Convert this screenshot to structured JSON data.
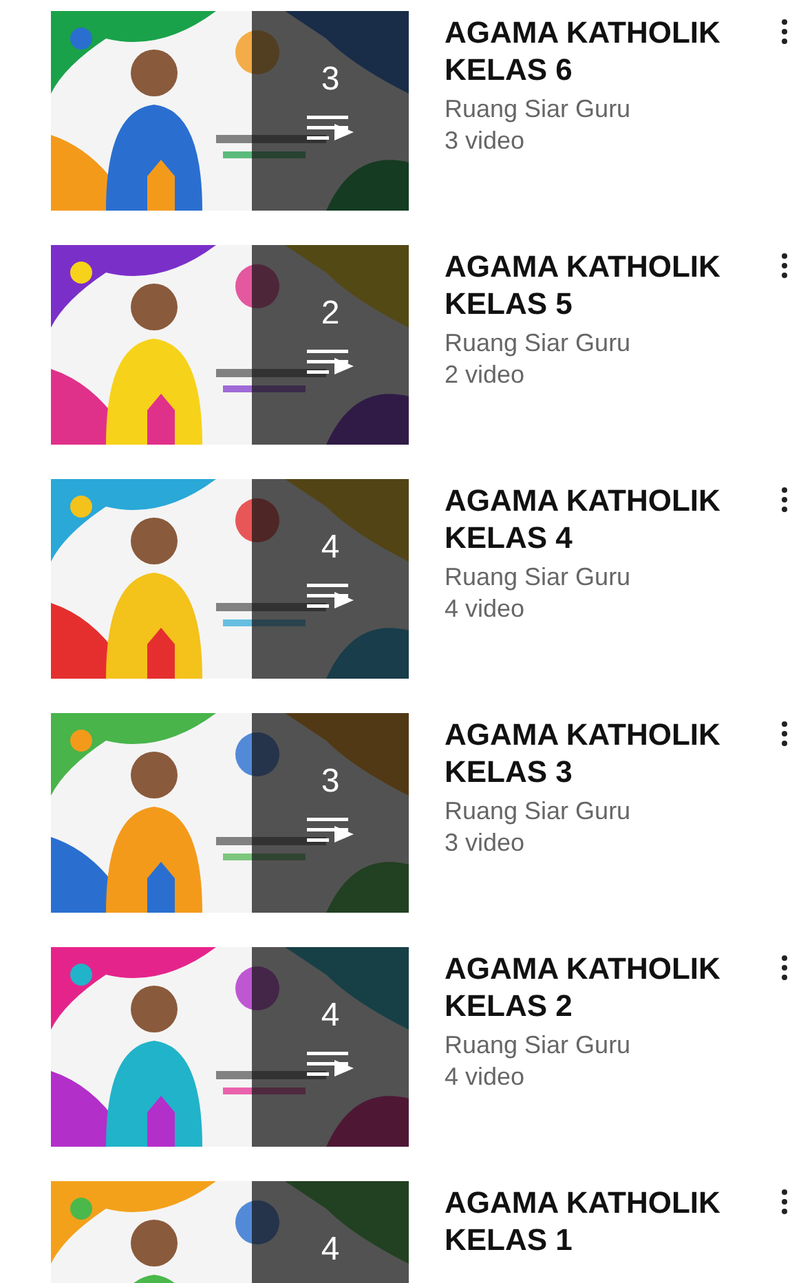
{
  "playlists": [
    {
      "count": "3",
      "playlist_icon": true,
      "title": "AGAMA KATHOLIK KELAS 6",
      "channel": "Ruang Siar Guru",
      "videos": "3 video"
    },
    {
      "count": "2",
      "playlist_icon": true,
      "title": "AGAMA KATHOLIK KELAS 5",
      "channel": "Ruang Siar Guru",
      "videos": "2 video"
    },
    {
      "count": "4",
      "playlist_icon": true,
      "title": "AGAMA KATHOLIK KELAS 4",
      "channel": "Ruang Siar Guru",
      "videos": "4 video"
    },
    {
      "count": "3",
      "playlist_icon": true,
      "title": "AGAMA KATHOLIK KELAS 3",
      "channel": "Ruang Siar Guru",
      "videos": "3 video"
    },
    {
      "count": "4",
      "playlist_icon": true,
      "title": "AGAMA KATHOLIK KELAS 2",
      "channel": "Ruang Siar Guru",
      "videos": "4 video"
    },
    {
      "count": "4",
      "title": "AGAMA KATHOLIK KELAS 1"
    }
  ]
}
